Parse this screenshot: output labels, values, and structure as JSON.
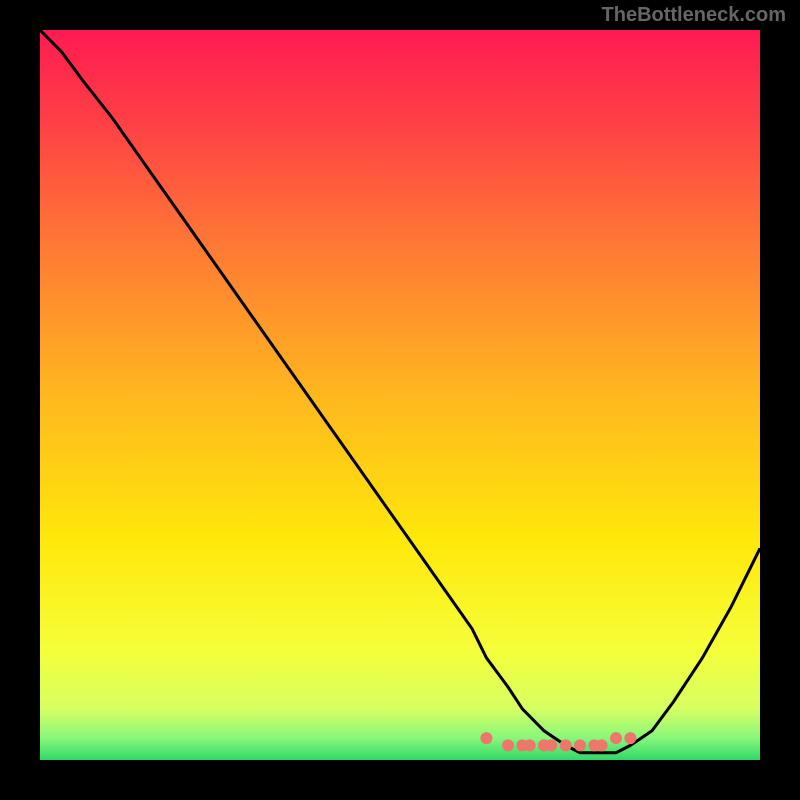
{
  "watermark": "TheBottleneck.com",
  "chart_data": {
    "type": "line",
    "title": "",
    "xlabel": "",
    "ylabel": "",
    "xlim": [
      0,
      100
    ],
    "ylim": [
      0,
      100
    ],
    "gradient": {
      "description": "Vertical gradient background red→orange→yellow→green (top to bottom)",
      "stops": [
        {
          "offset": 0.0,
          "color": "#ff1a52"
        },
        {
          "offset": 0.12,
          "color": "#ff3e46"
        },
        {
          "offset": 0.3,
          "color": "#ff7a34"
        },
        {
          "offset": 0.5,
          "color": "#ffb71f"
        },
        {
          "offset": 0.7,
          "color": "#ffe80a"
        },
        {
          "offset": 0.85,
          "color": "#f5ff3a"
        },
        {
          "offset": 0.93,
          "color": "#d6ff62"
        },
        {
          "offset": 0.97,
          "color": "#88f77a"
        },
        {
          "offset": 1.0,
          "color": "#30d86a"
        }
      ]
    },
    "series": [
      {
        "name": "bottleneck-curve",
        "color": "#000000",
        "x": [
          0,
          3,
          6,
          10,
          15,
          20,
          25,
          30,
          35,
          40,
          45,
          50,
          55,
          60,
          62,
          65,
          67,
          70,
          73,
          75,
          78,
          80,
          82,
          85,
          88,
          92,
          96,
          100
        ],
        "y": [
          100,
          97,
          93,
          88,
          81,
          74,
          67,
          60,
          53,
          46,
          39,
          32,
          25,
          18,
          14,
          10,
          7,
          4,
          2,
          1,
          1,
          1,
          2,
          4,
          8,
          14,
          21,
          29
        ]
      },
      {
        "name": "highlight-dots",
        "type": "scatter",
        "color": "#ee766b",
        "x": [
          62,
          65,
          67,
          68,
          70,
          71,
          73,
          75,
          77,
          78,
          80,
          82
        ],
        "y": [
          3,
          2,
          2,
          2,
          2,
          2,
          2,
          2,
          2,
          2,
          3,
          3
        ]
      }
    ]
  }
}
